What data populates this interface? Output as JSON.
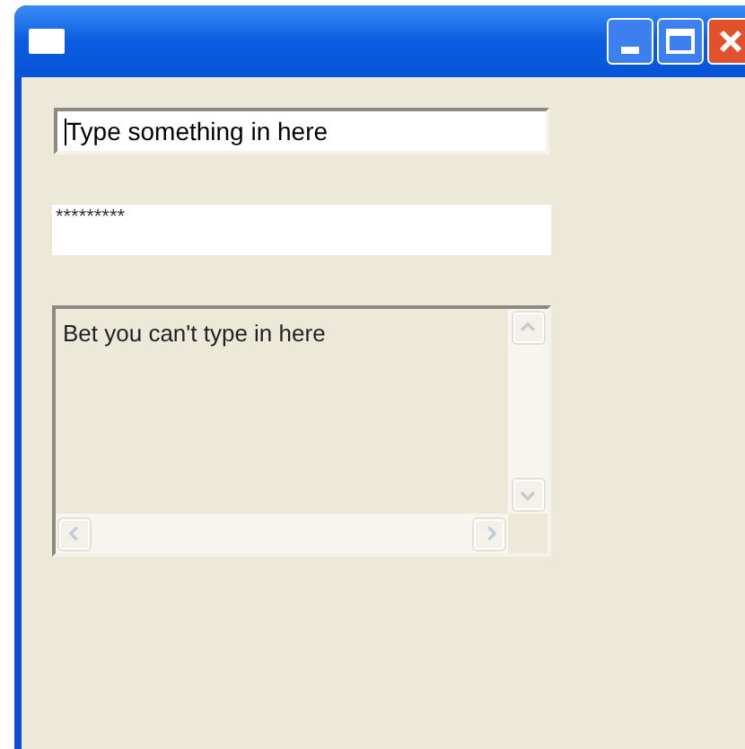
{
  "text_field": {
    "value": "Type something in here",
    "focused": true
  },
  "password_field": {
    "value": "*********"
  },
  "text_area": {
    "value": "Bet you can't type in here",
    "disabled": true
  }
}
